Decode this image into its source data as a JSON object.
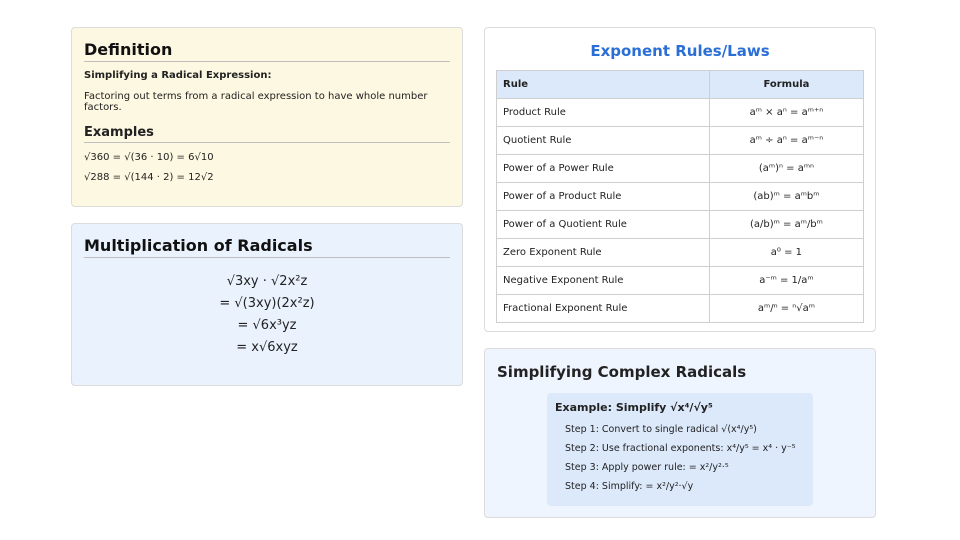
{
  "definition": {
    "title": "Definition",
    "subheading": "Simplifying a Radical Expression:",
    "description": "Factoring out terms from a radical expression to have whole number factors.",
    "examples_title": "Examples",
    "examples": [
      "√360 = √(36 · 10) = 6√10",
      "√288 = √(144 · 2) = 12√2"
    ]
  },
  "multiplication": {
    "title": "Multiplication of Radicals",
    "lines": [
      "√3xy · √2x²z",
      "= √(3xy)(2x²z)",
      "= √6x³yz",
      "= x√6xyz"
    ]
  },
  "rules": {
    "title": "Exponent Rules/Laws",
    "headers": [
      "Rule",
      "Formula"
    ],
    "rows": [
      {
        "rule": "Product Rule",
        "formula": "aᵐ × aⁿ = aᵐ⁺ⁿ"
      },
      {
        "rule": "Quotient Rule",
        "formula": "aᵐ ÷ aⁿ = aᵐ⁻ⁿ"
      },
      {
        "rule": "Power of a Power Rule",
        "formula": "(aᵐ)ⁿ = aᵐⁿ"
      },
      {
        "rule": "Power of a Product Rule",
        "formula": "(ab)ᵐ = aᵐbᵐ"
      },
      {
        "rule": "Power of a Quotient Rule",
        "formula": "(a/b)ᵐ = aᵐ/bᵐ"
      },
      {
        "rule": "Zero Exponent Rule",
        "formula": "a⁰ = 1"
      },
      {
        "rule": "Negative Exponent Rule",
        "formula": "a⁻ᵐ = 1/aᵐ"
      },
      {
        "rule": "Fractional Exponent Rule",
        "formula": "aᵐ/ⁿ = ⁿ√aᵐ"
      }
    ]
  },
  "complex": {
    "title": "Simplifying Complex Radicals",
    "example_heading": "Example: Simplify √x⁴/√y⁵",
    "steps": [
      "Step 1: Convert to single radical √(x⁴/y⁵)",
      "Step 2: Use fractional exponents: x⁴/y⁵ = x⁴ · y⁻⁵",
      "Step 3: Apply power rule: = x²/y²·⁵",
      "Step 4: Simplify: = x²/y²·√y"
    ]
  }
}
